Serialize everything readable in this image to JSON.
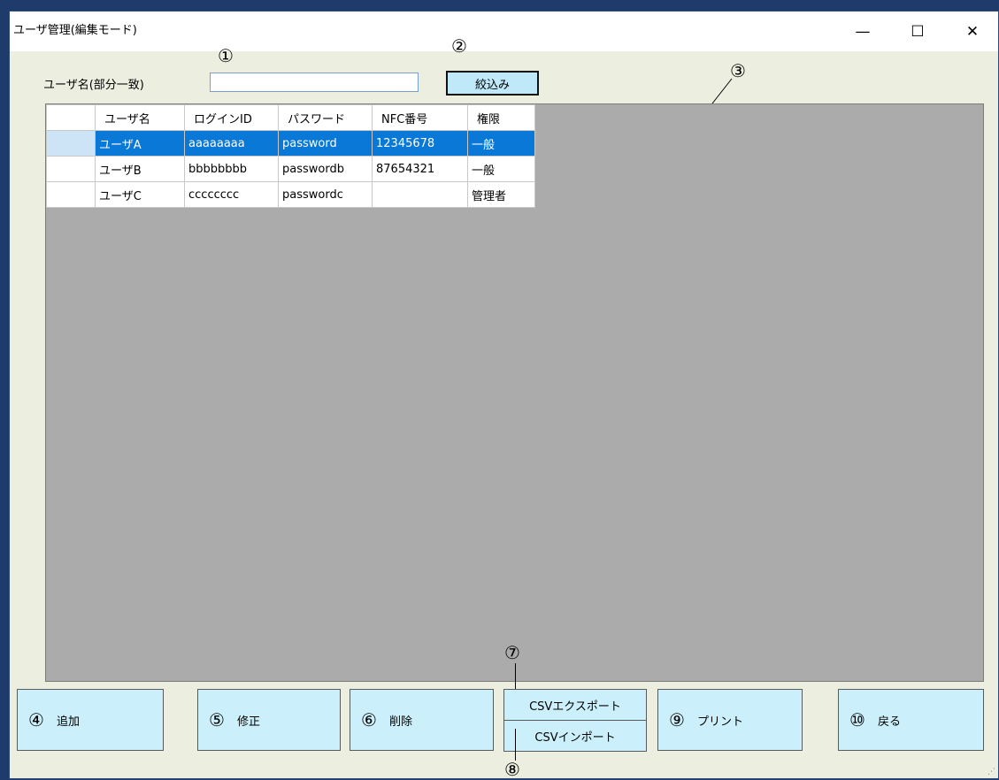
{
  "window": {
    "title": "ユーザ管理(編集モード)",
    "minimize": "—",
    "maximize": "☐",
    "close": "✕"
  },
  "filter": {
    "label": "ユーザ名(部分一致)",
    "value": "",
    "button": "絞込み"
  },
  "table": {
    "columns": [
      "",
      "ユーザ名",
      "ログインID",
      "パスワード",
      "NFC番号",
      "権限"
    ],
    "rows": [
      [
        "",
        "ユーザA",
        "aaaaaaaa",
        "password",
        "12345678",
        "一般"
      ],
      [
        "",
        "ユーザB",
        "bbbbbbbb",
        "passwordb",
        "87654321",
        "一般"
      ],
      [
        "",
        "ユーザC",
        "cccccccc",
        "passwordc",
        "",
        "管理者"
      ]
    ],
    "selected_row": 0
  },
  "annotations": {
    "n1": "①",
    "n2": "②",
    "n3": "③",
    "n7": "⑦",
    "n8": "⑧"
  },
  "actions": {
    "add": {
      "num": "④",
      "label": "追加"
    },
    "edit": {
      "num": "⑤",
      "label": "修正"
    },
    "delete": {
      "num": "⑥",
      "label": "削除"
    },
    "csv_export": "CSVエクスポート",
    "csv_import": "CSVインポート",
    "print": {
      "num": "⑨",
      "label": "プリント"
    },
    "back": {
      "num": "⑩",
      "label": "戻る"
    }
  },
  "colors": {
    "selection": "#0a78d7",
    "button_bg": "#ccf0fb",
    "grid_bg": "#ababab",
    "window_bg": "#eceee0"
  }
}
